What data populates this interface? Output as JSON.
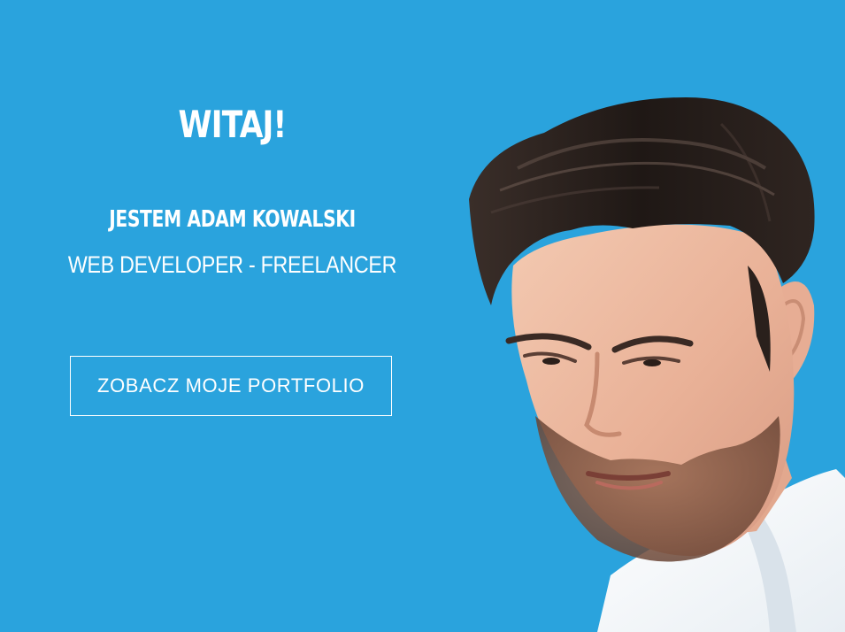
{
  "hero": {
    "greeting": "WITAJ!",
    "name_line": "JESTEM ADAM KOWALSKI",
    "role_line": "WEB DEVELOPER - FREELANCER",
    "cta_label": "ZOBACZ MOJE PORTFOLIO",
    "background_color": "#2aa3dd",
    "text_color": "#ffffff"
  },
  "portrait": {
    "alt": "portrait"
  }
}
